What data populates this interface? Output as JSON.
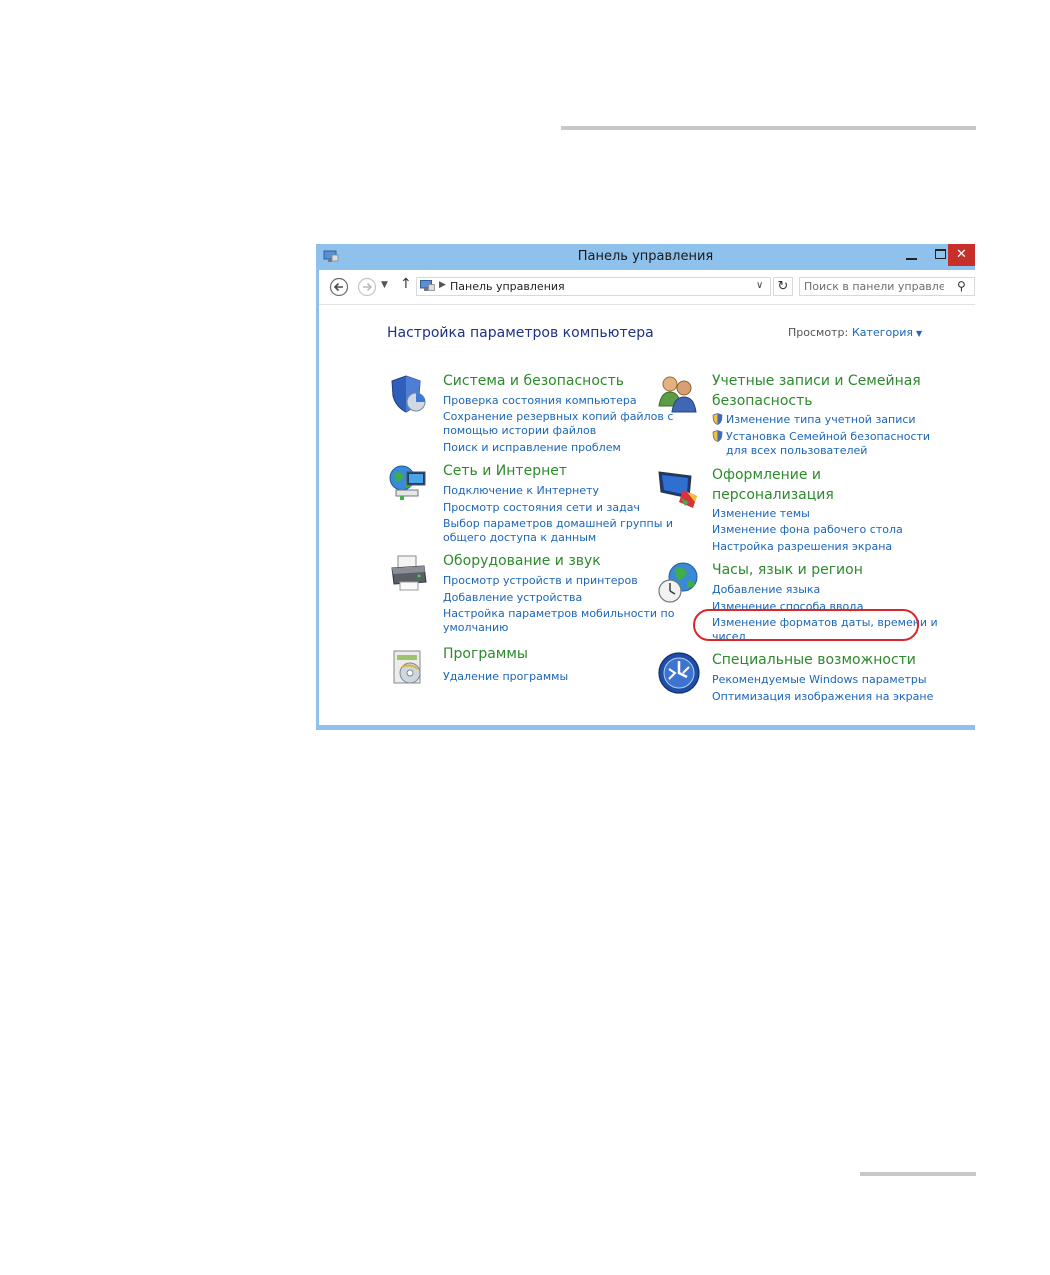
{
  "window": {
    "title": "Панель управления",
    "close_glyph": "✕",
    "colors": {
      "frame": "#8ec2ec",
      "close": "#c7302a"
    }
  },
  "addressbar": {
    "path": "Панель управления",
    "search_placeholder": "Поиск в панели управления"
  },
  "content": {
    "page_title": "Настройка параметров компьютера",
    "view_label": "Просмотр:",
    "view_value": "Категория"
  },
  "categories": {
    "system": {
      "title": "Система и безопасность",
      "links": [
        "Проверка состояния компьютера",
        "Сохранение резервных копий файлов с",
        "помощью истории файлов",
        "Поиск и исправление проблем"
      ]
    },
    "network": {
      "title": "Сеть и Интернет",
      "links": [
        "Подключение к Интернету",
        "Просмотр состояния сети и задач",
        "Выбор параметров домашней группы и",
        "общего доступа к данным"
      ]
    },
    "hardware": {
      "title": "Оборудование и звук",
      "links": [
        "Просмотр устройств и принтеров",
        "Добавление устройства",
        "Настройка параметров мобильности по",
        "умолчанию"
      ]
    },
    "programs": {
      "title": "Программы",
      "links": [
        "Удаление программы"
      ]
    },
    "accounts": {
      "title_line1": "Учетные записи и Семейная",
      "title_line2": "безопасность",
      "links": [
        "Изменение типа учетной записи",
        "Установка Семейной безопасности",
        "для всех пользователей"
      ]
    },
    "appearance": {
      "title_line1": "Оформление и",
      "title_line2": "персонализация",
      "links": [
        "Изменение темы",
        "Изменение фона рабочего стола",
        "Настройка разрешения экрана"
      ]
    },
    "clock": {
      "title": "Часы, язык и регион",
      "links": [
        "Добавление языка",
        "Изменение способа ввода",
        "Изменение форматов даты, времени и",
        "чисел"
      ]
    },
    "access": {
      "title": "Специальные возможности",
      "links": [
        "Рекомендуемые Windows параметры",
        "Оптимизация изображения на экране"
      ]
    }
  },
  "colors": {
    "category_title": "#2d8a2d",
    "link": "#1b66b8",
    "page_title": "#1e3287",
    "highlight": "#d9262c"
  }
}
